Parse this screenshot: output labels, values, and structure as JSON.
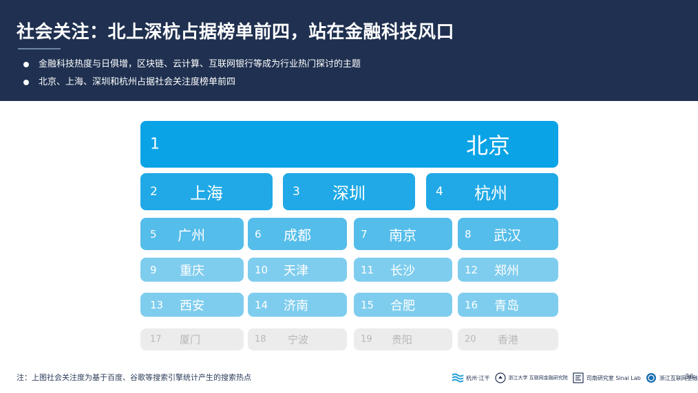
{
  "header": {
    "title": "社会关注：北上深杭占据榜单前四，站在金融科技风口",
    "bullets": [
      "金融科技热度与日俱增，区块链、云计算、互联网银行等成为行业热门探讨的主题",
      "北京、上海、深圳和杭州占据社会关注度榜单前四"
    ]
  },
  "ranking": [
    {
      "rank": "1",
      "city": "北京"
    },
    {
      "rank": "2",
      "city": "上海"
    },
    {
      "rank": "3",
      "city": "深圳"
    },
    {
      "rank": "4",
      "city": "杭州"
    },
    {
      "rank": "5",
      "city": "广州"
    },
    {
      "rank": "6",
      "city": "成都"
    },
    {
      "rank": "7",
      "city": "南京"
    },
    {
      "rank": "8",
      "city": "武汉"
    },
    {
      "rank": "9",
      "city": "重庆"
    },
    {
      "rank": "10",
      "city": "天津"
    },
    {
      "rank": "11",
      "city": "长沙"
    },
    {
      "rank": "12",
      "city": "郑州"
    },
    {
      "rank": "13",
      "city": "西安"
    },
    {
      "rank": "14",
      "city": "济南"
    },
    {
      "rank": "15",
      "city": "合肥"
    },
    {
      "rank": "16",
      "city": "青岛"
    },
    {
      "rank": "17",
      "city": "厦门"
    },
    {
      "rank": "18",
      "city": "宁波"
    },
    {
      "rank": "19",
      "city": "贵阳"
    },
    {
      "rank": "20",
      "city": "香港"
    }
  ],
  "colors": {
    "header_bg": "#1f3050",
    "tier1": "#0aa3e6",
    "tier2": "#20a9e6",
    "tier3": "#55bdea",
    "tier4": "#7fcdee",
    "tier5": "#ececec"
  },
  "footer": {
    "note": "注：上图社会关注度为基于百度、谷歌等搜索引擎统计产生的搜索热点",
    "page_number": "36",
    "logos": [
      {
        "icon": "hangzhou-jianggan-logo-icon",
        "text": "杭州·江干"
      },
      {
        "icon": "zhejiang-university-logo-icon",
        "text": "浙江大学 互联网金融研究院"
      },
      {
        "icon": "sinai-lab-logo-icon",
        "text": "司南研究室 Sinai Lab"
      },
      {
        "icon": "zhejiang-internet-finance-association-logo-icon",
        "text": "浙江互联网金融联合会"
      }
    ]
  }
}
